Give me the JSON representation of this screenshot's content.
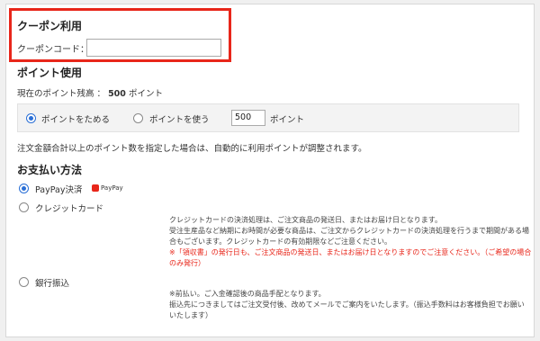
{
  "coupon": {
    "title": "クーポン利用",
    "label": "クーポンコード：",
    "input_value": ""
  },
  "points": {
    "title": "ポイント使用",
    "balance_label": "現在のポイント残高 ：",
    "balance_value": "500",
    "balance_unit": "ポイント",
    "option_save": "ポイントをためる",
    "option_use": "ポイントを使う",
    "use_value": "500",
    "use_unit": "ポイント",
    "selected": "save",
    "notice": "注文金額合計以上のポイント数を指定した場合は、自動的に利用ポイントが調整されます。"
  },
  "payment": {
    "title": "お支払い方法",
    "options": [
      {
        "label": "PayPay決済",
        "selected": true
      },
      {
        "label": "クレジットカード",
        "selected": false
      },
      {
        "label": "銀行振込",
        "selected": false
      }
    ],
    "paypay_logo": "PayPay",
    "credit_notes": [
      "クレジットカードの決済処理は、ご注文商品の発送日、またはお届け日となります。",
      "受注生産品など納期にお時間が必要な商品は、ご注文からクレジットカードの決済処理を行うまで期間がある場",
      "合もございます。クレジットカードの有効期限などご注意ください。"
    ],
    "credit_red_notes": [
      "※「領収書」の発行日も、ご注文商品の発送日、またはお届け日となりますのでご注意ください。（ご希望の場合",
      "のみ発行）"
    ],
    "bank_notes": [
      "※前払い。ご入金確認後の商品手配となります。",
      "振込先につきましてはご注文受付後、改めてメールでご案内をいたします。（振込手数料はお客様負担でお願い",
      "いたします）"
    ]
  },
  "colors": {
    "highlight_border": "#e8261a",
    "radio_selected": "#2a6fd6"
  }
}
